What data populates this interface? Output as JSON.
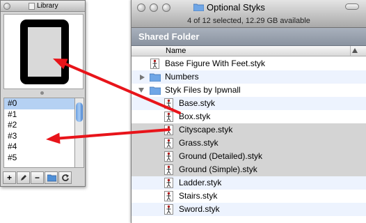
{
  "library": {
    "title": "Library",
    "items": [
      "#0",
      "#1",
      "#2",
      "#3",
      "#4",
      "#5"
    ],
    "selected_index": 0,
    "toolbar": {
      "add_label": "+",
      "remove_label": "−"
    }
  },
  "finder": {
    "title": "Optional Styks",
    "status": "4 of 12 selected, 12.29 GB available",
    "section": "Shared Folder",
    "column_header": "Name",
    "rows": [
      {
        "name": "Base Figure With Feet.styk",
        "kind": "file",
        "indent": 0,
        "selected": false
      },
      {
        "name": "Numbers",
        "kind": "folder-closed",
        "indent": 0,
        "selected": false
      },
      {
        "name": "Styk Files by Ipwnall",
        "kind": "folder-open",
        "indent": 0,
        "selected": false
      },
      {
        "name": "Base.styk",
        "kind": "file",
        "indent": 1,
        "selected": false
      },
      {
        "name": "Box.styk",
        "kind": "file",
        "indent": 1,
        "selected": false
      },
      {
        "name": "Cityscape.styk",
        "kind": "file",
        "indent": 1,
        "selected": true
      },
      {
        "name": "Grass.styk",
        "kind": "file",
        "indent": 1,
        "selected": true
      },
      {
        "name": "Ground (Detailed).styk",
        "kind": "file",
        "indent": 1,
        "selected": true
      },
      {
        "name": "Ground (Simple).styk",
        "kind": "file",
        "indent": 1,
        "selected": true
      },
      {
        "name": "Ladder.styk",
        "kind": "file",
        "indent": 1,
        "selected": false
      },
      {
        "name": "Stairs.styk",
        "kind": "file",
        "indent": 1,
        "selected": false
      },
      {
        "name": "Sword.styk",
        "kind": "file",
        "indent": 1,
        "selected": false
      }
    ]
  },
  "colors": {
    "arrow": "#e8141a",
    "selection_list": "#b5d1f3",
    "selection_finder": "#d4d4d4",
    "stripe": "#edf3fe",
    "header": "#8e97a4"
  }
}
